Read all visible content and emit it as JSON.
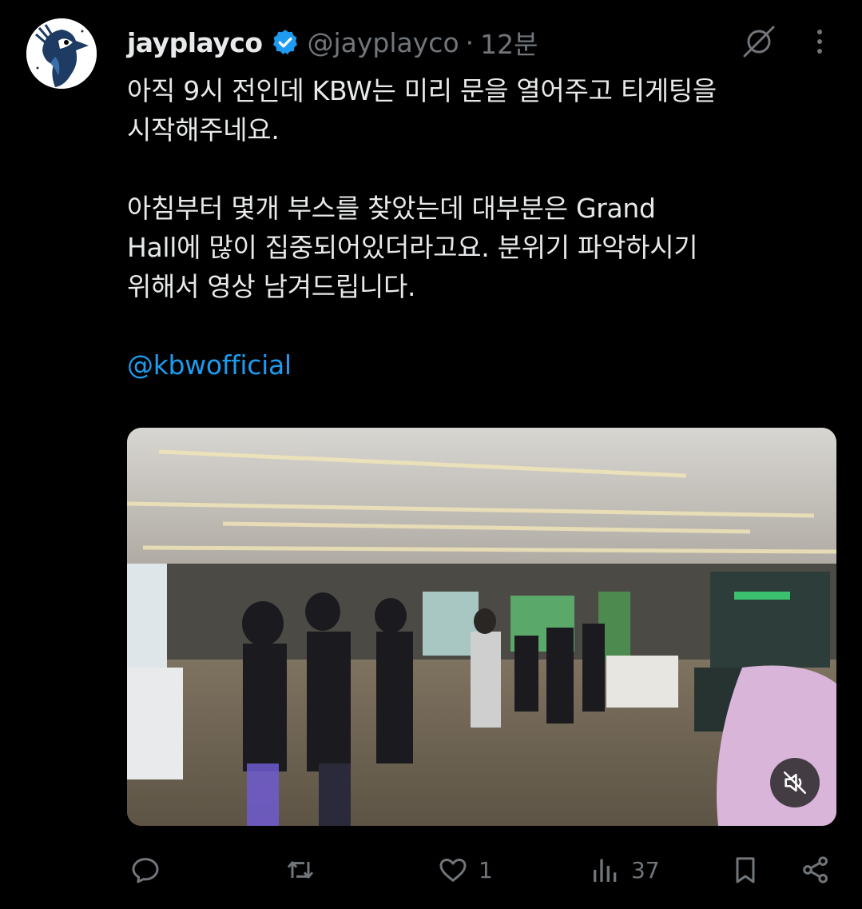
{
  "author": {
    "display_name": "jayplayco",
    "handle": "@jayplayco",
    "time": "12분",
    "separator": "·",
    "verified": true,
    "avatar_icon": "blue-jay-avatar"
  },
  "post": {
    "lines": [
      "아직 9시 전인데 KBW는 미리 문을 열어주고 티게팅을",
      "시작해주네요.",
      "",
      "아침부터 몇개 부스를 찾았는데 대부분은 Grand",
      "Hall에 많이 집중되어있더라고요. 분위기 파악하시기",
      "위해서 영상 남겨드립니다.",
      ""
    ],
    "mention": "@kbwofficial"
  },
  "media": {
    "type": "video",
    "mute_icon": "speaker-muted-icon"
  },
  "actions": {
    "reply": {
      "icon": "reply-icon",
      "count": ""
    },
    "repost": {
      "icon": "repost-icon",
      "count": ""
    },
    "like": {
      "icon": "heart-icon",
      "count": "1"
    },
    "views": {
      "icon": "views-icon",
      "count": "37"
    },
    "bookmark": {
      "icon": "bookmark-icon"
    },
    "share": {
      "icon": "share-icon"
    }
  },
  "colors": {
    "background": "#000000",
    "text": "#e7e9ea",
    "secondary": "#71767b",
    "link": "#1d9bf0",
    "verified": "#1d9bf0"
  }
}
